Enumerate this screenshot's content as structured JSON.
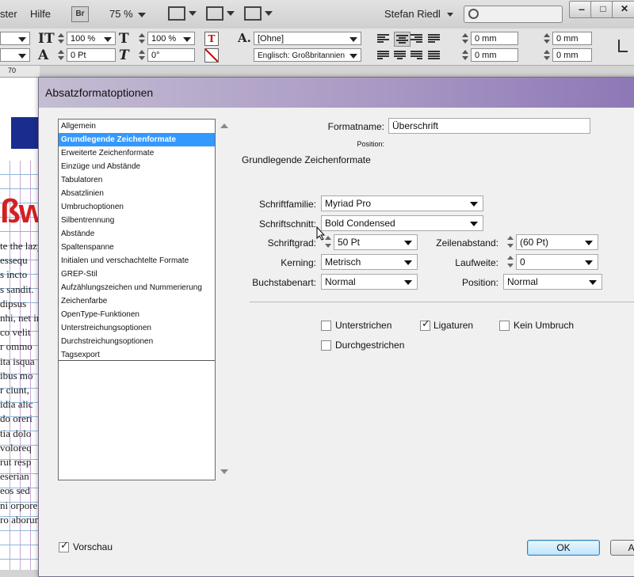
{
  "app": {
    "menu_partial": "ster",
    "menu_help": "Hilfe",
    "bridge_label": "Br",
    "zoom": "75 %",
    "user": "Stefan Riedl",
    "window_min": "–",
    "window_max": "□",
    "window_close": "✕"
  },
  "control_panel": {
    "vert_scale": "100 %",
    "horiz_scale": "100 %",
    "baseline_shift": "0 Pt",
    "skew": "0°",
    "char_style": "[Ohne]",
    "language": "Englisch: Großbritannien",
    "indent_left": "0 mm",
    "indent_right": "0 mm",
    "space_before": "0 mm",
    "space_after": "0 mm"
  },
  "document": {
    "ruler_mark": "70",
    "headline_fragment": "ßw",
    "lines": [
      "te the lazy",
      "essequ",
      "s incto",
      "s sandit.",
      "dipsus",
      "nhi, net in",
      "co velit",
      "r ommo",
      "ita isqua",
      "ibus mo",
      "r ciunt,",
      "idia alic",
      "do oreri",
      "tia dolo",
      "voloreq",
      "rut resp",
      "eserian",
      "eos sed",
      "ni orpore",
      "ro aborum"
    ]
  },
  "dialog": {
    "title": "Absatzformatoptionen",
    "categories": [
      "Allgemein",
      "Grundlegende Zeichenformate",
      "Erweiterte Zeichenformate",
      "Einzüge und Abstände",
      "Tabulatoren",
      "Absatzlinien",
      "Umbruchoptionen",
      "Silbentrennung",
      "Abstände",
      "Spaltenspanne",
      "Initialen und verschachtelte Formate",
      "GREP-Stil",
      "Aufzählungszeichen und Nummerierung",
      "Zeichenfarbe",
      "OpenType-Funktionen",
      "Unterstreichungsoptionen",
      "Durchstreichungsoptionen",
      "Tagsexport"
    ],
    "selected_category": "Grundlegende Zeichenformate",
    "formatname_label": "Formatname:",
    "formatname_value": "Überschrift",
    "position_label": "Position:",
    "section_title": "Grundlegende Zeichenformate",
    "schriftfamilie_label": "Schriftfamilie:",
    "schriftfamilie_value": "Myriad Pro",
    "schriftschnitt_label": "Schriftschnitt:",
    "schriftschnitt_value": "Bold Condensed",
    "schriftgrad_label": "Schriftgrad:",
    "schriftgrad_value": "50 Pt",
    "zeilenabstand_label": "Zeilenabstand:",
    "zeilenabstand_value": "(60 Pt)",
    "kerning_label": "Kerning:",
    "kerning_value": "Metrisch",
    "laufweite_label": "Laufweite:",
    "laufweite_value": "0",
    "buchstabenart_label": "Buchstabenart:",
    "buchstabenart_value": "Normal",
    "position2_label": "Position:",
    "position2_value": "Normal",
    "checkboxes": {
      "unterstrichen": {
        "label": "Unterstrichen",
        "checked": false
      },
      "ligaturen": {
        "label": "Ligaturen",
        "checked": true
      },
      "kein_umbruch": {
        "label": "Kein Umbruch",
        "checked": false
      },
      "durchgestrichen": {
        "label": "Durchgestrichen",
        "checked": false
      }
    },
    "vorschau_label": "Vorschau",
    "vorschau_checked": true,
    "ok_label": "OK",
    "abbrechen_label": "Ab"
  },
  "colors": {
    "selection": "#3399ff",
    "title_gradient_end": "#8d77b6",
    "doc_headline": "#d42020"
  }
}
